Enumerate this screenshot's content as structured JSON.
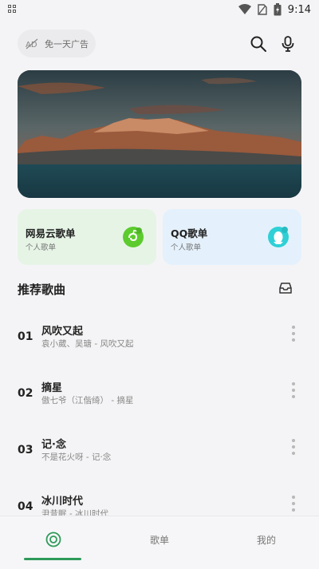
{
  "status_bar": {
    "time": "9:14"
  },
  "search": {
    "ad_label": "免一天广告"
  },
  "cards": [
    {
      "title": "网易云歌单",
      "subtitle": "个人歌单",
      "accent": "#5ccb2e"
    },
    {
      "title": "QQ歌单",
      "subtitle": "个人歌单",
      "accent": "#2fd0d6"
    }
  ],
  "section": {
    "title": "推荐歌曲"
  },
  "songs": [
    {
      "num": "01",
      "title": "风吹又起",
      "sub": "袁小葳、吴瑭 - 风吹又起"
    },
    {
      "num": "02",
      "title": "摘星",
      "sub": "傲七爷（江偕绮） - 摘星"
    },
    {
      "num": "03",
      "title": "记·念",
      "sub": "不是花火呀 - 记·念"
    },
    {
      "num": "04",
      "title": "冰川时代",
      "sub": "尹昔眠 - 冰川时代"
    }
  ],
  "nav": {
    "playlist_label": "歌单",
    "mine_label": "我的",
    "accent": "#2e9a5a"
  }
}
